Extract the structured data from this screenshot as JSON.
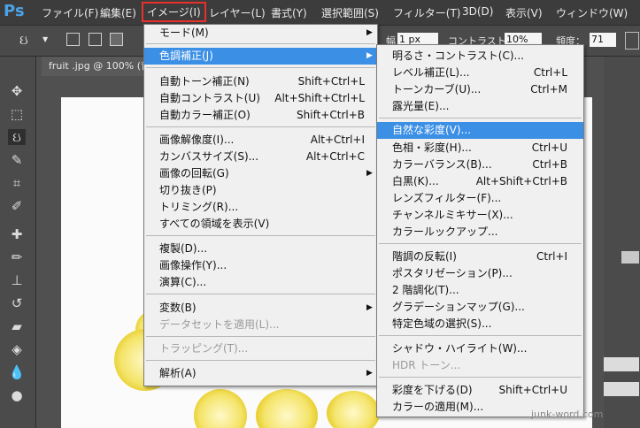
{
  "app": {
    "logo": "Ps"
  },
  "menubar": [
    {
      "label": "ファイル(F)"
    },
    {
      "label": "編集(E)"
    },
    {
      "label": "イメージ(I)"
    },
    {
      "label": "レイヤー(L)"
    },
    {
      "label": "書式(Y)"
    },
    {
      "label": "選択範囲(S)"
    },
    {
      "label": "フィルター(T)"
    },
    {
      "label": "3D(D)"
    },
    {
      "label": "表示(V)"
    },
    {
      "label": "ウィンドウ(W)"
    }
  ],
  "options": {
    "width_value": "1 px",
    "contrast_label": "コントラスト：",
    "contrast_value": "10%",
    "frequency_label": "頻度：",
    "frequency_value": "71"
  },
  "document": {
    "tab_title": "fruit .jpg @ 100% (背"
  },
  "image_menu": {
    "items": [
      {
        "label": "モード(M)",
        "shortcut": "",
        "submenu": true
      },
      {
        "label": "色調補正(J)",
        "shortcut": "",
        "submenu": true,
        "highlighted": true
      },
      {
        "label": "自動トーン補正(N)",
        "shortcut": "Shift+Ctrl+L"
      },
      {
        "label": "自動コントラスト(U)",
        "shortcut": "Alt+Shift+Ctrl+L"
      },
      {
        "label": "自動カラー補正(O)",
        "shortcut": "Shift+Ctrl+B"
      },
      {
        "label": "画像解像度(I)...",
        "shortcut": "Alt+Ctrl+I"
      },
      {
        "label": "カンバスサイズ(S)...",
        "shortcut": "Alt+Ctrl+C"
      },
      {
        "label": "画像の回転(G)",
        "shortcut": "",
        "submenu": true
      },
      {
        "label": "切り抜き(P)",
        "shortcut": ""
      },
      {
        "label": "トリミング(R)...",
        "shortcut": ""
      },
      {
        "label": "すべての領域を表示(V)",
        "shortcut": ""
      },
      {
        "label": "複製(D)...",
        "shortcut": ""
      },
      {
        "label": "画像操作(Y)...",
        "shortcut": ""
      },
      {
        "label": "演算(C)...",
        "shortcut": ""
      },
      {
        "label": "変数(B)",
        "shortcut": "",
        "submenu": true
      },
      {
        "label": "データセットを適用(L)...",
        "shortcut": "",
        "disabled": true
      },
      {
        "label": "トラッピング(T)...",
        "shortcut": "",
        "disabled": true
      },
      {
        "label": "解析(A)",
        "shortcut": "",
        "submenu": true
      }
    ]
  },
  "adjust_menu": {
    "items": [
      {
        "label": "明るさ・コントラスト(C)...",
        "shortcut": ""
      },
      {
        "label": "レベル補正(L)...",
        "shortcut": "Ctrl+L"
      },
      {
        "label": "トーンカーブ(U)...",
        "shortcut": "Ctrl+M"
      },
      {
        "label": "露光量(E)...",
        "shortcut": ""
      },
      {
        "label": "自然な彩度(V)...",
        "shortcut": "",
        "highlighted": true
      },
      {
        "label": "色相・彩度(H)...",
        "shortcut": "Ctrl+U"
      },
      {
        "label": "カラーバランス(B)...",
        "shortcut": "Ctrl+B"
      },
      {
        "label": "白黒(K)...",
        "shortcut": "Alt+Shift+Ctrl+B"
      },
      {
        "label": "レンズフィルター(F)...",
        "shortcut": ""
      },
      {
        "label": "チャンネルミキサー(X)...",
        "shortcut": ""
      },
      {
        "label": "カラールックアップ...",
        "shortcut": ""
      },
      {
        "label": "階調の反転(I)",
        "shortcut": "Ctrl+I"
      },
      {
        "label": "ポスタリゼーション(P)...",
        "shortcut": ""
      },
      {
        "label": "2 階調化(T)...",
        "shortcut": ""
      },
      {
        "label": "グラデーションマップ(G)...",
        "shortcut": ""
      },
      {
        "label": "特定色域の選択(S)...",
        "shortcut": ""
      },
      {
        "label": "シャドウ・ハイライト(W)...",
        "shortcut": ""
      },
      {
        "label": "HDR トーン...",
        "shortcut": "",
        "disabled": true
      },
      {
        "label": "彩度を下げる(D)",
        "shortcut": "Shift+Ctrl+U"
      },
      {
        "label": "カラーの適用(M)...",
        "shortcut": ""
      }
    ]
  },
  "watermark": "junk-word.com",
  "colors": {
    "highlight": "#3b8fe5",
    "active_outline": "#e8302c",
    "menubar_bg": "#3c3c3c"
  }
}
